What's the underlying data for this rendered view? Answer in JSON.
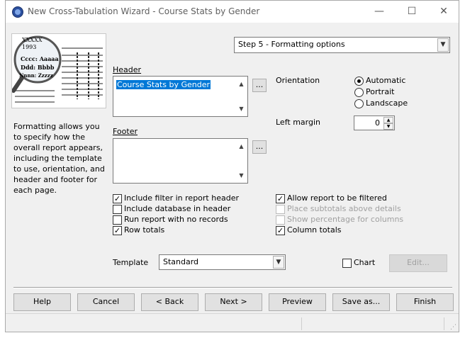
{
  "window": {
    "title": "New Cross-Tabulation Wizard - Course Stats by Gender",
    "minimize_glyph": "—",
    "maximize_glyph": "☐",
    "close_glyph": "✕"
  },
  "illustration": {
    "line1": "XXXXX",
    "line2": "1993",
    "line3": "Cccc: Aaaaa",
    "line4": "Ddd: Bbbb",
    "line5": "Nnnn: Zzzzz"
  },
  "description": "Formatting allows you to specify how the overall report appears, including the template to use, orientation, and header and footer for each page.",
  "step_select": {
    "value": "Step 5 - Formatting options"
  },
  "header_label": "Header",
  "header_text": "Course Stats by Gender",
  "footer_label": "Footer",
  "footer_text": "",
  "ellipsis_label": "...",
  "orientation": {
    "label": "Orientation",
    "options": [
      "Automatic",
      "Portrait",
      "Landscape"
    ],
    "selected": "Automatic"
  },
  "left_margin": {
    "label": "Left margin",
    "value": "0"
  },
  "checkboxes_left": [
    {
      "label": "Include filter in report header",
      "checked": true
    },
    {
      "label": "Include database in header",
      "checked": false
    },
    {
      "label": "Run report with no records",
      "checked": false
    },
    {
      "label": "Row totals",
      "checked": true
    }
  ],
  "checkboxes_right": [
    {
      "label": "Allow report to be filtered",
      "checked": true,
      "enabled": true
    },
    {
      "label": "Place subtotals above details",
      "checked": false,
      "enabled": false
    },
    {
      "label": "Show percentage for columns",
      "checked": false,
      "enabled": false
    },
    {
      "label": "Column totals",
      "checked": true,
      "enabled": true
    }
  ],
  "template": {
    "label": "Template",
    "value": "Standard"
  },
  "chart": {
    "label": "Chart",
    "checked": false
  },
  "edit_button": "Edit...",
  "buttons": {
    "help": "Help",
    "cancel": "Cancel",
    "back": "< Back",
    "next": "Next >",
    "preview": "Preview",
    "save_as": "Save as...",
    "finish": "Finish"
  }
}
